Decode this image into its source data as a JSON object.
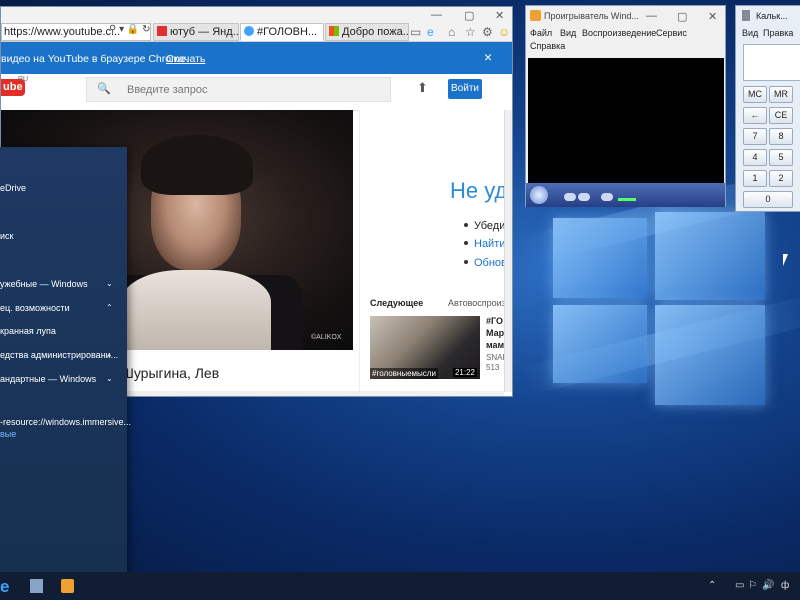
{
  "browser": {
    "address": "https://www.youtube.c...",
    "tabs": [
      {
        "label": "ютуб — Янд..."
      },
      {
        "label": "#ГОЛОВН..."
      },
      {
        "label": "Добро пожа..."
      }
    ],
    "infobar_text": "видео на YouTube в браузере Chrome.",
    "infobar_link": "Скачать",
    "infobar_close": "×"
  },
  "youtube": {
    "logo": "ube",
    "logo_region": "RU",
    "search_placeholder": "Введите запрос",
    "signin_label": "Войти",
    "video_watermark": "©ALIKOX",
    "video_title": "Шурыгина, Лев",
    "sidebar": {
      "heading": "Не уд",
      "bullets": [
        "Убеди",
        "Найти",
        "Обнов"
      ],
      "next_label": "Следующее",
      "autoplay_label": "Автовоспроиз",
      "thumb_caption": "#головныемысли",
      "thumb_duration": "21:22",
      "related_lines": [
        "#ГО",
        "Мар",
        "мам",
        "SNAI",
        "513"
      ]
    }
  },
  "start_menu": {
    "items": [
      {
        "label": "eDrive"
      },
      {
        "label": "иск"
      },
      {
        "label": "ужебные — Windows"
      },
      {
        "label": "ец. возможности"
      },
      {
        "label": "кранная лупа"
      },
      {
        "label": "едства администрировани..."
      },
      {
        "label": "андартные — Windows"
      },
      {
        "label": "-resource://windows.immersive..."
      },
      {
        "label": "вые"
      }
    ]
  },
  "media_player": {
    "title": "Проигрыватель Wind...",
    "menu": [
      "Файл",
      "Вид",
      "Воспроизведение",
      "Сервис",
      "Справка"
    ]
  },
  "calculator": {
    "title": "Кальк...",
    "menu": [
      "Вид",
      "Правка"
    ],
    "buttons": [
      "MC",
      "MR",
      "←",
      "CE",
      "7",
      "8",
      "4",
      "5",
      "1",
      "2",
      "0"
    ]
  },
  "taskbar": {
    "tray_text": "ф"
  },
  "colors": {
    "accent": "#1a73c9",
    "youtube_red": "#e52d27",
    "desktop_blue": "#14448e"
  }
}
